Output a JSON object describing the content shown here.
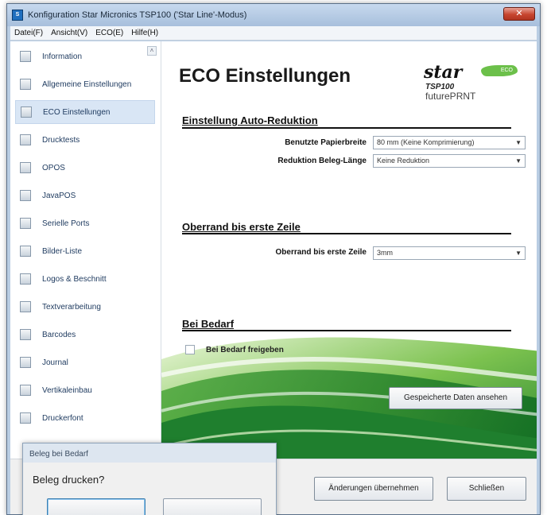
{
  "window": {
    "title": "Konfiguration Star Micronics TSP100 ('Star Line'-Modus)",
    "close_label": "✕"
  },
  "menu": [
    "Datei(F)",
    "Ansicht(V)",
    "ECO(E)",
    "Hilfe(H)"
  ],
  "sidebar": {
    "items": [
      {
        "label": "Information",
        "selected": false
      },
      {
        "label": "Allgemeine Einstellungen",
        "selected": false
      },
      {
        "label": "ECO Einstellungen",
        "selected": true
      },
      {
        "label": "Drucktests",
        "selected": false
      },
      {
        "label": "OPOS",
        "selected": false
      },
      {
        "label": "JavaPOS",
        "selected": false
      },
      {
        "label": "Serielle Ports",
        "selected": false
      },
      {
        "label": "Bilder-Liste",
        "selected": false
      },
      {
        "label": "Logos & Beschnitt",
        "selected": false
      },
      {
        "label": "Textverarbeitung",
        "selected": false
      },
      {
        "label": "Barcodes",
        "selected": false
      },
      {
        "label": "Journal",
        "selected": false
      },
      {
        "label": "Vertikaleinbau",
        "selected": false
      },
      {
        "label": "Druckerfont",
        "selected": false
      }
    ]
  },
  "content": {
    "title": "ECO Einstellungen",
    "logo": {
      "brand": "star",
      "badge": "ECO",
      "model": "TSP100",
      "tagline": "futurePRNT"
    },
    "section1": {
      "heading": "Einstellung Auto-Reduktion",
      "paper_width_label": "Benutzte Papierbreite",
      "paper_width_value": "80 mm (Keine Komprimierung)",
      "reduction_label": "Reduktion Beleg-Länge",
      "reduction_value": "Keine Reduktion"
    },
    "section2": {
      "heading": "Oberrand bis erste Zeile",
      "top_margin_label": "Oberrand bis erste Zeile",
      "top_margin_value": "3mm"
    },
    "section3": {
      "heading": "Bei Bedarf",
      "checkbox_label": "Bei Bedarf freigeben",
      "checked": false,
      "show_saved_button": "Gespeicherte Daten ansehen"
    }
  },
  "footer": {
    "apply_button": "Änderungen übernehmen",
    "close_button": "Schließen"
  },
  "dialog": {
    "title": "Beleg bei Bedarf",
    "question": "Beleg drucken?"
  },
  "colors": {
    "selected_item": "#d9e6f5",
    "swoosh_green": "#2f9a3a",
    "title_bar": "#b9cde3",
    "close_red": "#c7452f"
  }
}
